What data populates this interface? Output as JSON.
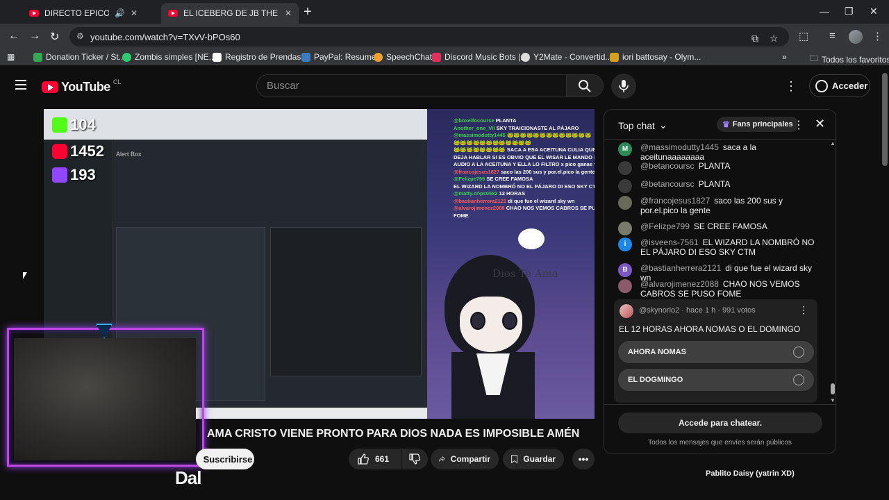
{
  "browser": {
    "tabs": [
      {
        "title": "DIRECTO EPICO PASEN DIO",
        "active": false,
        "audio": true
      },
      {
        "title": "EL ICEBERG DE JB THE VOICE. -",
        "active": true
      }
    ],
    "url": "youtube.com/watch?v=TXvV-bPOs60",
    "bookmarks": [
      {
        "label": "Donation Ticker / St...",
        "color": "#34a853"
      },
      {
        "label": "Zombis simples [NE...",
        "color": "#2ecc71"
      },
      {
        "label": "Registro de Prendas...",
        "color": "#ffffff"
      },
      {
        "label": "PayPal: Resumen",
        "color": "#3b7bbf"
      },
      {
        "label": "SpeechChat",
        "color": "#f0a030"
      },
      {
        "label": "Discord Music Bots |...",
        "color": "#e03060"
      },
      {
        "label": "Y2Mate - Convertid...",
        "color": "#dddddd"
      },
      {
        "label": "iori battosay - Olym...",
        "color": "#d4a020"
      }
    ],
    "bookmarks_folder": "Todos los favoritos"
  },
  "youtube": {
    "logo_text": "YouTube",
    "country": "CL",
    "search_placeholder": "Buscar",
    "signin": "Acceder"
  },
  "video": {
    "overlay_counts": [
      "104",
      "1452",
      "193"
    ],
    "stream_chat": [
      {
        "name": "@boxeifocourse",
        "text": "PLANTA"
      },
      {
        "name": "Another_one_VII",
        "text": "SKY TRAICIONASTE AL PÁJARO"
      },
      {
        "name": "@massimodutty1445",
        "text": "🐸🐸🐸🐸🐸🐸🐸🐸🐸🐸🐸🐸🐸"
      },
      {
        "name": "",
        "text": "🐸🐸🐸🐸🐸🐸🐸🐸🐸🐸🐸🐸"
      },
      {
        "name": "",
        "text": "🐸🐸🐸🐸🐸🐸🐸🐸 SACA A ESA ACEITUNA CULIA QUE NO DEJA HABLAR SI ES OBVIO QUE EL WISAR LE MANDO EL AUDIO A LA ACEITUNA Y ELLA LO FILTRO x pico ganas vista"
      },
      {
        "name": "@francojesus1827",
        "text": "saco las 200 sus y por.el.pico la gente"
      },
      {
        "name": "@Felizpe799",
        "text": "SE CREE FAMOSA"
      },
      {
        "name": "",
        "text": "EL WIZARD LA NOMBRÓ NO EL PÁJARO DI ESO SKY CTM"
      },
      {
        "name": "@matty.crips0582",
        "text": "12 HORAS"
      },
      {
        "name": "@bastianherrera2121",
        "text": "di que fue el wizard sky wn"
      },
      {
        "name": "@alvarojimenez2088",
        "text": "CHAO NOS VEMOS CABROS SE PUSO FOME"
      }
    ],
    "art_text": "Dios Te Ama",
    "webcam_name": "Dal"
  },
  "meta": {
    "title": "AMA CRISTO VIENE PRONTO PARA DIOS NADA ES IMPOSIBLE AMÉN",
    "subscribe": "Suscribirse",
    "likes": "661",
    "share": "Compartir",
    "save": "Guardar",
    "next_item": "Pablito Daisy (yatrin XD)"
  },
  "chat": {
    "header": "Top chat",
    "fans": "Fans principales",
    "messages": [
      {
        "author": "@massimodutty1445",
        "text": "saca a la aceitunaaaaaaaa",
        "initial": "M",
        "color": "#2e8b57"
      },
      {
        "author": "@betancoursc",
        "text": "PLANTA",
        "initial": "",
        "color": "#3a3a3a"
      },
      {
        "author": "@betancoursc",
        "text": "PLANTA",
        "initial": "",
        "color": "#3a3a3a"
      },
      {
        "author": "@francojesus1827",
        "text": "saco las 200 sus y por.el.pico la gente",
        "initial": "",
        "color": "#6a6a5a"
      },
      {
        "author": "@Felizpe799",
        "text": "SE CREE FAMOSA",
        "initial": "",
        "color": "#7a7a6a"
      },
      {
        "author": "@isveens-7561",
        "text": "EL WIZARD LA NOMBRÓ NO EL PÁJARO DI ESO SKY CTM",
        "initial": "i",
        "color": "#1e88e5"
      },
      {
        "author": "@bastianherrera2121",
        "text": "di que fue el wizard sky wn",
        "initial": "B",
        "color": "#7e57c2"
      },
      {
        "author": "@alvarojimenez2088",
        "text": "CHAO NOS VEMOS CABROS SE PUSO FOME",
        "initial": "",
        "color": "#8a5a6a"
      }
    ],
    "poll": {
      "author": "@skynorio2",
      "time": "hace 1 h",
      "votes": "991 votos",
      "question": "EL 12 HORAS AHORA NOMAS O EL DOMINGO",
      "options": [
        "AHORA NOMAS",
        "EL DOGMINGO"
      ]
    },
    "cta": "Accede para chatear.",
    "note": "Todos los mensajes que envíes serán públicos"
  }
}
